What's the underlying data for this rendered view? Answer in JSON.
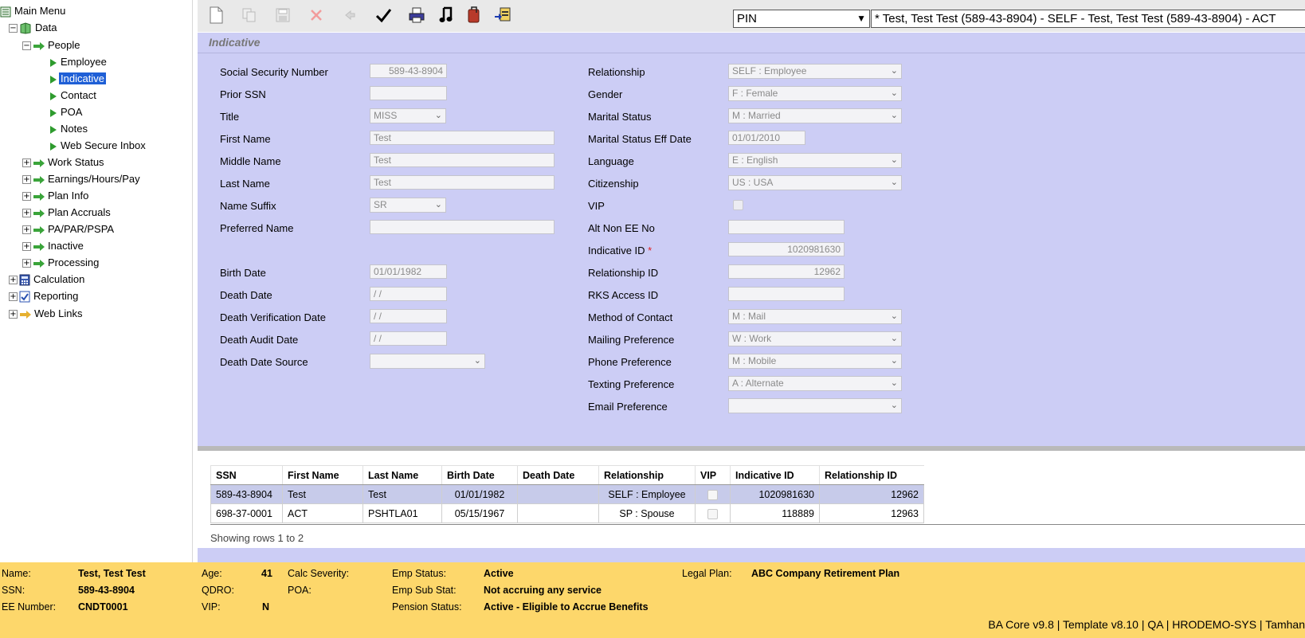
{
  "tree": {
    "main_menu": "Main Menu",
    "data": "Data",
    "people": "People",
    "people_items": [
      "Employee",
      "Indicative",
      "Contact",
      "POA",
      "Notes",
      "Web Secure Inbox"
    ],
    "data_groups": [
      "Work Status",
      "Earnings/Hours/Pay",
      "Plan Info",
      "Plan Accruals",
      "PA/PAR/PSPA",
      "Inactive",
      "Processing"
    ],
    "calculation": "Calculation",
    "reporting": "Reporting",
    "web_links": "Web Links",
    "selected": "Indicative",
    "expand_minus": "−",
    "expand_plus": "+"
  },
  "toolbar": {
    "pin_value": "PIN",
    "member_text": "* Test, Test Test (589-43-8904) - SELF - Test, Test Test (589-43-8904) - ACT",
    "icons": [
      "new-doc-icon",
      "copy-icon",
      "save-icon",
      "delete-icon",
      "undo-icon",
      "check-icon",
      "print-icon",
      "music-note-icon",
      "attachment-icon",
      "import-icon",
      "exit-icon"
    ]
  },
  "section": {
    "title": "Indicative"
  },
  "form_left": {
    "ssn_label": "Social Security Number",
    "ssn_value": "589-43-8904",
    "prior_ssn_label": "Prior SSN",
    "prior_ssn_value": "",
    "title_label": "Title",
    "title_value": "MISS",
    "first_name_label": "First Name",
    "first_name_value": "Test",
    "middle_name_label": "Middle Name",
    "middle_name_value": "Test",
    "last_name_label": "Last Name",
    "last_name_value": "Test",
    "name_suffix_label": "Name Suffix",
    "name_suffix_value": "SR",
    "preferred_name_label": "Preferred Name",
    "preferred_name_value": "",
    "birth_date_label": "Birth Date",
    "birth_date_value": "01/01/1982",
    "death_date_label": "Death Date",
    "death_date_value": " / /",
    "death_verif_label": "Death Verification Date",
    "death_verif_value": " / /",
    "death_audit_label": "Death Audit Date",
    "death_audit_value": " / /",
    "death_source_label": "Death Date Source",
    "death_source_value": ""
  },
  "form_right": {
    "relationship_label": "Relationship",
    "relationship_value": "SELF : Employee",
    "gender_label": "Gender",
    "gender_value": "F : Female",
    "marital_label": "Marital Status",
    "marital_value": "M : Married",
    "marital_eff_label": "Marital Status Eff Date",
    "marital_eff_value": "01/01/2010",
    "language_label": "Language",
    "language_value": "E : English",
    "citizenship_label": "Citizenship",
    "citizenship_value": "US : USA",
    "vip_label": "VIP",
    "alt_non_ee_label": "Alt Non EE No",
    "alt_non_ee_value": "",
    "indicative_id_label": "Indicative ID",
    "indicative_id_required": "*",
    "indicative_id_value": "1020981630",
    "relationship_id_label": "Relationship ID",
    "relationship_id_value": "12962",
    "rks_label": "RKS Access ID",
    "rks_value": "",
    "contact_method_label": "Method of Contact",
    "contact_method_value": "M : Mail",
    "mailing_pref_label": "Mailing Preference",
    "mailing_pref_value": "W : Work",
    "phone_pref_label": "Phone Preference",
    "phone_pref_value": "M : Mobile",
    "texting_pref_label": "Texting Preference",
    "texting_pref_value": "A : Alternate",
    "email_pref_label": "Email Preference",
    "email_pref_value": ""
  },
  "grid": {
    "headers": [
      "SSN",
      "First Name",
      "Last Name",
      "Birth Date",
      "Death Date",
      "Relationship",
      "VIP",
      "Indicative ID",
      "Relationship ID"
    ],
    "rows": [
      {
        "ssn": "589-43-8904",
        "first": "Test",
        "last": "Test",
        "birth": "01/01/1982",
        "death": "",
        "rel": "SELF : Employee",
        "ind_id": "1020981630",
        "rel_id": "12962"
      },
      {
        "ssn": "698-37-0001",
        "first": "ACT",
        "last": "PSHTLA01",
        "birth": "05/15/1967",
        "death": "",
        "rel": "SP : Spouse",
        "ind_id": "118889",
        "rel_id": "12963"
      }
    ],
    "status": "Showing rows 1 to 2"
  },
  "footer": {
    "name_label": "Name:",
    "name_value": "Test, Test Test",
    "ssn_label": "SSN:",
    "ssn_value": "589-43-8904",
    "ee_label": "EE Number:",
    "ee_value": "CNDT0001",
    "age_label": "Age:",
    "age_value": "41",
    "qdro_label": "QDRO:",
    "vip_label": "VIP:",
    "vip_value": "N",
    "calc_sev_label": "Calc Severity:",
    "poa_label": "POA:",
    "emp_status_label": "Emp Status:",
    "emp_status_value": "Active",
    "emp_sub_label": "Emp Sub Stat:",
    "emp_sub_value": "Not accruing any service",
    "pension_label": "Pension Status:",
    "pension_value": "Active - Eligible to Accrue Benefits",
    "legal_plan_label": "Legal Plan:",
    "legal_plan_value": "ABC Company Retirement Plan",
    "version": "BA Core v9.8 | Template v8.10 | QA | HRODEMO-SYS | Tamhan"
  },
  "colors": {
    "form_bg": "#cccdf5",
    "footer_bg": "#fdd76b",
    "selection": "#1f5fd6",
    "grid_selected_row": "#c7cbea",
    "toolbar_bg": "#e9e9e9"
  }
}
